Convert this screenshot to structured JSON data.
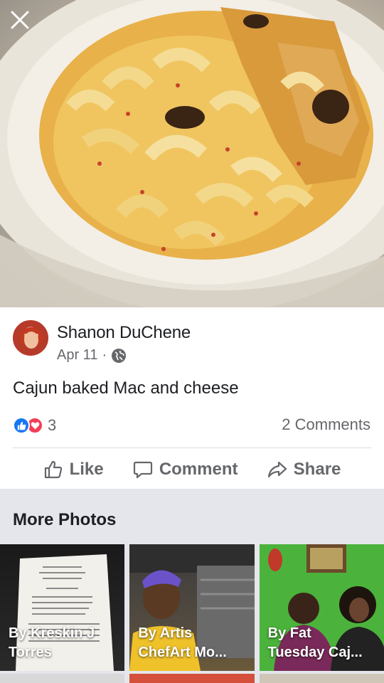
{
  "viewer": {
    "close_icon": "close-icon"
  },
  "post": {
    "author": "Shanon DuChene",
    "date": "Apr 11",
    "separator": "·",
    "privacy_icon": "globe-icon",
    "caption": "Cajun baked Mac and cheese",
    "reaction_count": "3",
    "reaction_icons": [
      "like-reaction-icon",
      "love-reaction-icon"
    ],
    "comments_label": "2 Comments"
  },
  "actions": {
    "like": "Like",
    "comment": "Comment",
    "share": "Share"
  },
  "more_photos": {
    "title": "More Photos",
    "items": [
      {
        "label_line1": "By Kreskin J",
        "label_line2": "Torres"
      },
      {
        "label_line1": "By Artis",
        "label_line2": "ChefArt Mo..."
      },
      {
        "label_line1": "By Fat",
        "label_line2": "Tuesday Caj..."
      }
    ]
  },
  "colors": {
    "brand_blue": "#1877f2",
    "love_red": "#f33e58",
    "secondary_text": "#65676b",
    "section_bg": "#e4e6eb"
  }
}
